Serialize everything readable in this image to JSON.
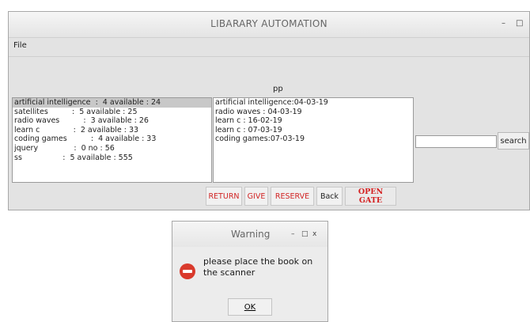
{
  "window": {
    "title": "LIBARARY AUTOMATION",
    "minimize_glyph": "–",
    "maximize_glyph": "□"
  },
  "menu": {
    "file": "File"
  },
  "pp_label": "pp",
  "books": [
    "artificial intelligence  :  4 available : 24",
    "satellites          :  5 available : 25",
    "radio waves          :  3 available : 26",
    "learn c              :  2 available : 33",
    "coding games          :  4 available : 33",
    "jquery               :  0 no : 56",
    "ss                 :  5 available : 555"
  ],
  "selected_book_index": 0,
  "dates": [
    "artificial intelligence:04-03-19",
    "radio waves : 04-03-19",
    "learn c : 16-02-19",
    "learn c : 07-03-19",
    "coding games:07-03-19"
  ],
  "search": {
    "value": "",
    "button_label": "search"
  },
  "actions": {
    "return": "RETURN",
    "give": "GIVE",
    "reserve": "RESERVE",
    "back": "Back",
    "open_gate": "OPEN GATE"
  },
  "dialog": {
    "title": "Warning",
    "minimize_glyph": "–",
    "maximize_glyph": "□",
    "close_glyph": "x",
    "message": "please place the book on the scanner",
    "ok_label": "OK"
  },
  "colors": {
    "red_text": "#d12424",
    "warning_icon": "#d93a2c"
  }
}
